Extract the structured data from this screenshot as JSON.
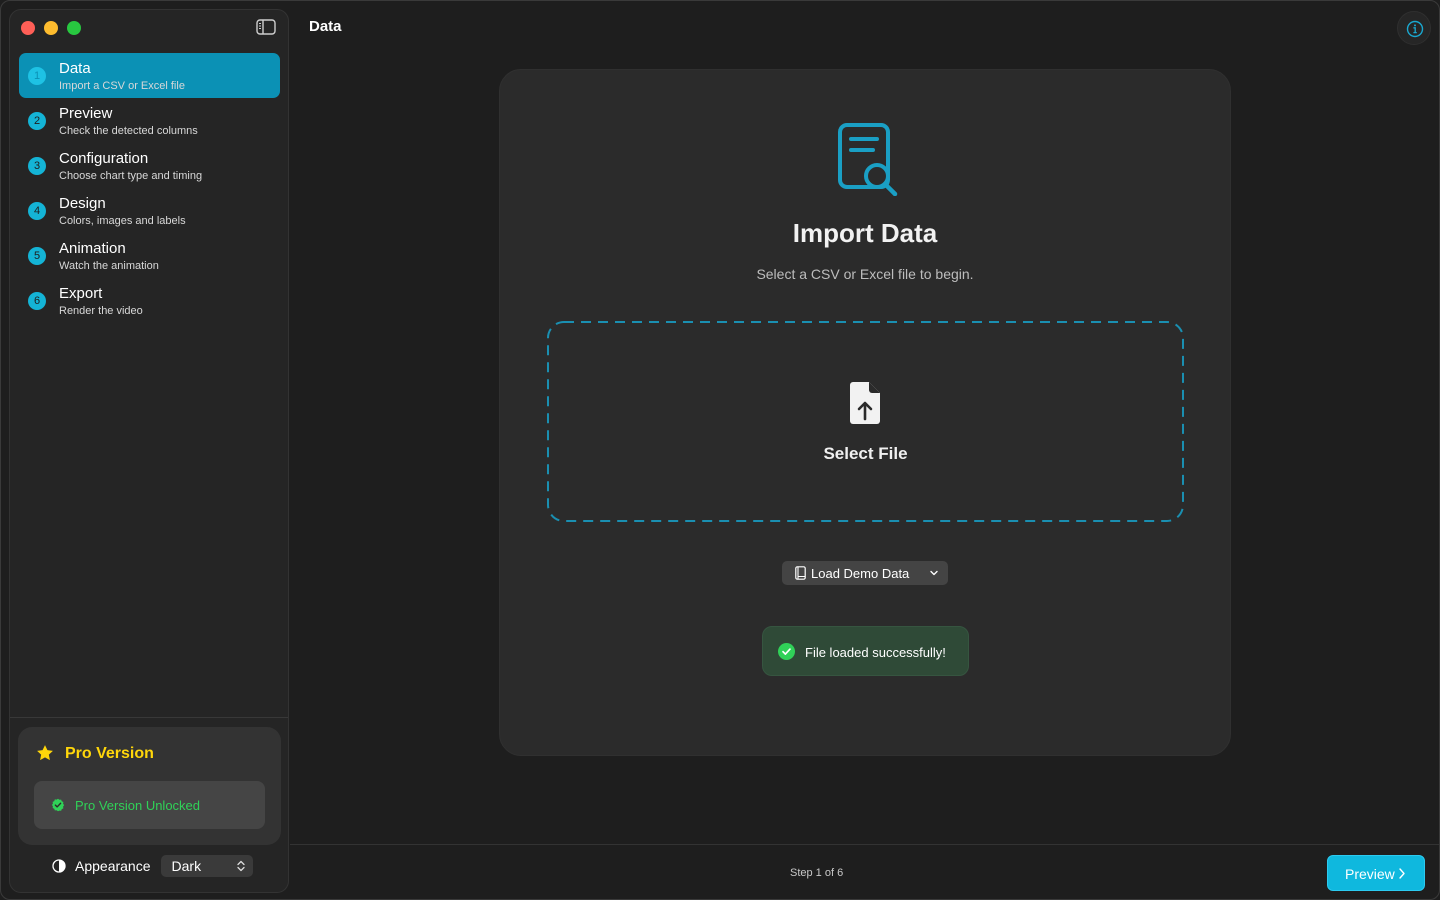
{
  "window": {
    "traffic_lights": [
      "close",
      "minimize",
      "zoom"
    ]
  },
  "sidebar": {
    "toggle_icon": "sidebar-left-icon",
    "steps": [
      {
        "number": "1",
        "title": "Data",
        "subtitle": "Import a CSV or Excel file",
        "active": true
      },
      {
        "number": "2",
        "title": "Preview",
        "subtitle": "Check the detected columns",
        "active": false
      },
      {
        "number": "3",
        "title": "Configuration",
        "subtitle": "Choose chart type and timing",
        "active": false
      },
      {
        "number": "4",
        "title": "Design",
        "subtitle": "Colors, images and labels",
        "active": false
      },
      {
        "number": "5",
        "title": "Animation",
        "subtitle": "Watch the animation",
        "active": false
      },
      {
        "number": "6",
        "title": "Export",
        "subtitle": "Render the video",
        "active": false
      }
    ],
    "pro": {
      "title": "Pro Version",
      "status": "Pro Version Unlocked"
    },
    "appearance": {
      "label": "Appearance",
      "value": "Dark"
    }
  },
  "main": {
    "title": "Data",
    "card": {
      "title": "Import Data",
      "subtitle": "Select a CSV or Excel file to begin.",
      "dropzone_label": "Select File",
      "demo_button": "Load Demo Data",
      "toast": "File loaded successfully!"
    },
    "footer": {
      "step_count": "Step 1 of 6",
      "next_button": "Preview"
    }
  },
  "colors": {
    "accent": "#0fb8de",
    "active_step": "#0b91b5",
    "pro_yellow": "#ffd60a",
    "success_green": "#30d158"
  }
}
